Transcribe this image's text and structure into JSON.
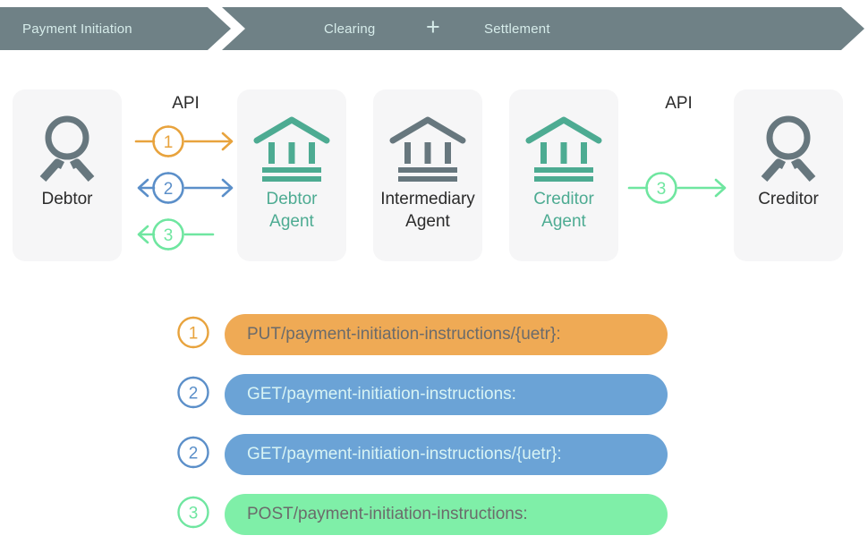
{
  "banner": {
    "background_color": "#6f8186",
    "text_color": "#d6ecea",
    "segments": [
      {
        "label": "Payment Initiation"
      },
      {
        "label": "Clearing"
      },
      {
        "label": "+"
      },
      {
        "label": "Settlement"
      }
    ],
    "payment_initiation_label": "Payment Initiation",
    "clearing_label": "Clearing",
    "plus_label": "+",
    "settlement_label": "Settlement"
  },
  "colors": {
    "orange": "#e8a33d",
    "blue": "#5b8fc9",
    "green": "#6fe6a0",
    "teal": "#4dab92",
    "slate": "#67777e",
    "pill_orange": "#efaa55",
    "pill_blue": "#6ba3d6",
    "pill_green": "#7fefa8",
    "card_bg": "#f6f6f7",
    "dark_text": "#2b2b2b"
  },
  "actors": [
    {
      "id": "debtor",
      "label": "Debtor",
      "icon": "person-icon",
      "style": "person",
      "color": "#2b2b2b"
    },
    {
      "id": "debtor-agent",
      "label": "Debtor\nAgent",
      "label_line1": "Debtor",
      "label_line2": "Agent",
      "icon": "bank-icon",
      "style": "bank-teal",
      "color": "#4dab92"
    },
    {
      "id": "intermediary-agent",
      "label": "Intermediary\nAgent",
      "label_line1": "Intermediary",
      "label_line2": "Agent",
      "icon": "bank-icon",
      "style": "bank-slate",
      "color": "#2b2b2b"
    },
    {
      "id": "creditor-agent",
      "label": "Creditor\nAgent",
      "label_line1": "Creditor",
      "label_line2": "Agent",
      "icon": "bank-icon",
      "style": "bank-teal",
      "color": "#4dab92"
    },
    {
      "id": "creditor",
      "label": "Creditor",
      "icon": "person-icon",
      "style": "person",
      "color": "#2b2b2b"
    }
  ],
  "api_groups": [
    {
      "id": "left",
      "title": "API",
      "flows": [
        {
          "number": "1",
          "color": "#e8a33d",
          "left_connector": "line",
          "right_connector": "arrow"
        },
        {
          "number": "2",
          "color": "#5b8fc9",
          "left_connector": "arrow",
          "right_connector": "arrow"
        },
        {
          "number": "3",
          "color": "#6fe6a0",
          "left_connector": "arrow",
          "right_connector": "line"
        }
      ]
    },
    {
      "id": "right",
      "title": "API",
      "flows": [
        {
          "number": "3",
          "color": "#6fe6a0",
          "left_connector": "line",
          "right_connector": "arrow"
        }
      ]
    }
  ],
  "legend": [
    {
      "number": "1",
      "marker_color": "#e8a33d",
      "pill_color": "#efaa55",
      "text": "PUT/payment-initiation-instructions/{uetr}:",
      "text_color": "#6b6b6b",
      "width": "wide"
    },
    {
      "number": "2",
      "marker_color": "#5b8fc9",
      "pill_color": "#6ba3d6",
      "text": "GET/payment-initiation-instructions:",
      "text_color": "#d7f3f4",
      "width": "wide"
    },
    {
      "number": "2",
      "marker_color": "#5b8fc9",
      "pill_color": "#6ba3d6",
      "text": "GET/payment-initiation-instructions/{uetr}:",
      "text_color": "#d7f3f4",
      "width": "wide"
    },
    {
      "number": "3",
      "marker_color": "#6fe6a0",
      "pill_color": "#7fefa8",
      "text": "POST/payment-initiation-instructions:",
      "text_color": "#6b6b6b",
      "width": "wide"
    }
  ]
}
